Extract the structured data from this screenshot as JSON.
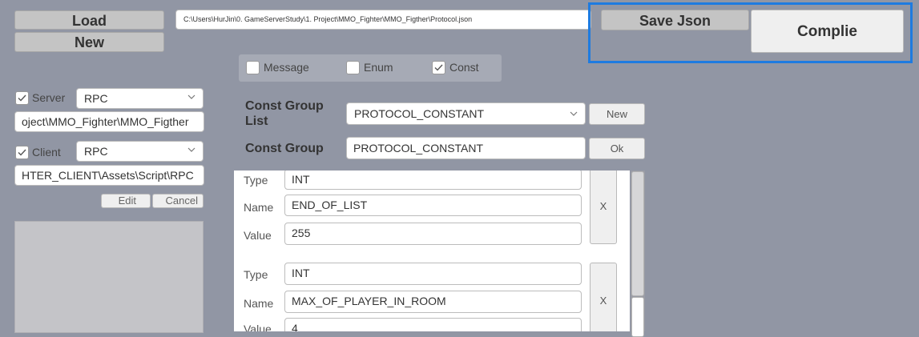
{
  "top": {
    "load_label": "Load",
    "new_label": "New",
    "path": "C:\\Users\\HurJin\\0. GameServerStudy\\1. Project\\MMO_Fighter\\MMO_Figther\\Protocol.json",
    "save_json_label": "Save Json",
    "compile_label": "Complie"
  },
  "type_tabs": [
    {
      "label": "Message",
      "checked": false
    },
    {
      "label": "Enum",
      "checked": false
    },
    {
      "label": "Const",
      "checked": true
    }
  ],
  "left": {
    "server_label": "Server",
    "server_mode": "RPC",
    "server_path": "oject\\MMO_Fighter\\MMO_Figther",
    "client_label": "Client",
    "client_mode": "RPC",
    "client_path": "HTER_CLIENT\\Assets\\Script\\RPC",
    "edit_label": "Edit",
    "cancel_label": "Cancel"
  },
  "const_group": {
    "list_label": "Const Group List",
    "list_selected": "PROTOCOL_CONSTANT",
    "new_label": "New",
    "group_label": "Const Group",
    "group_value": "PROTOCOL_CONSTANT",
    "ok_label": "Ok"
  },
  "entries": [
    {
      "type_label": "Type",
      "type": "INT",
      "name_label": "Name",
      "name": "END_OF_LIST",
      "value_label": "Value",
      "value": "255",
      "remove_label": "X"
    },
    {
      "type_label": "Type",
      "type": "INT",
      "name_label": "Name",
      "name": "MAX_OF_PLAYER_IN_ROOM",
      "value_label": "Value",
      "value": "4",
      "remove_label": "X"
    }
  ],
  "colors": {
    "background": "#9196a4",
    "highlight": "#1e7be0"
  }
}
